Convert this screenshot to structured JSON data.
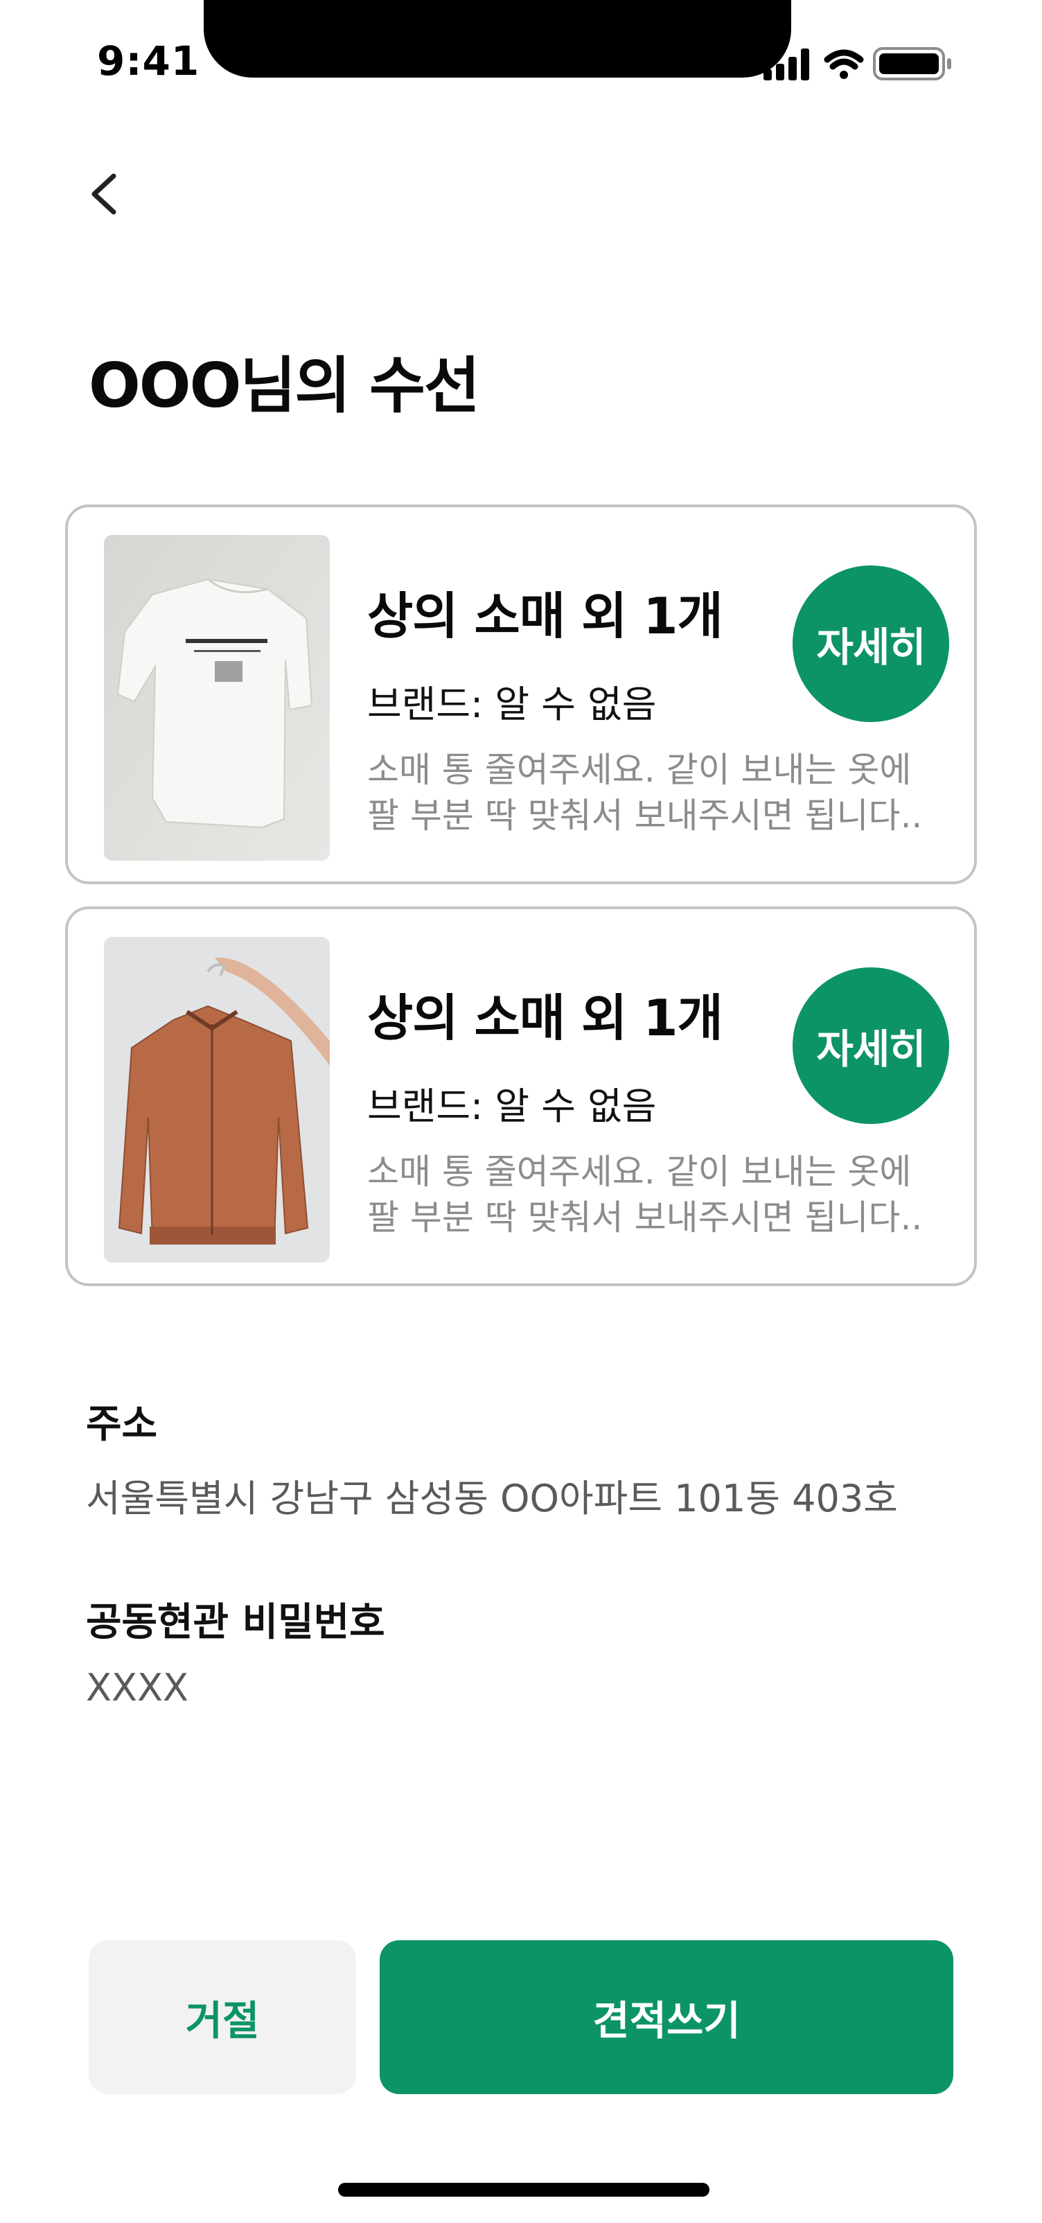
{
  "status_bar": {
    "time": "9:41",
    "icons": [
      "cellular-signal-icon",
      "wifi-icon",
      "battery-icon"
    ]
  },
  "header": {
    "back_icon": "chevron-left-icon",
    "title": "OOO님의 수선"
  },
  "requests": [
    {
      "image": "white-tshirt-photo",
      "title": "상의 소매 외 1개",
      "brand": "브랜드: 알 수 없음",
      "description": "소매 통 줄여주세요. 같이 보내는 옷에\n팔 부분 딱 맞춰서 보내주시면 됩니다..",
      "detail_label": "자세히"
    },
    {
      "image": "brown-bomber-jacket-photo",
      "title": "상의 소매 외 1개",
      "brand": "브랜드: 알 수 없음",
      "description": "소매 통 줄여주세요. 같이 보내는 옷에\n팔 부분 딱 맞춰서 보내주시면 됩니다..",
      "detail_label": "자세히"
    }
  ],
  "address": {
    "label": "주소",
    "value": "서울특별시 강남구 삼성동 OO아파트 101동 403호"
  },
  "door_code": {
    "label": "공동현관 비밀번호",
    "value": "XXXX"
  },
  "actions": {
    "reject_label": "거절",
    "quote_label": "견적쓰기"
  },
  "colors": {
    "accent": "#0c9466",
    "card_border": "#c4c4c4",
    "secondary_button_bg": "#f2f2f2",
    "muted_text": "#8c8c8c"
  }
}
